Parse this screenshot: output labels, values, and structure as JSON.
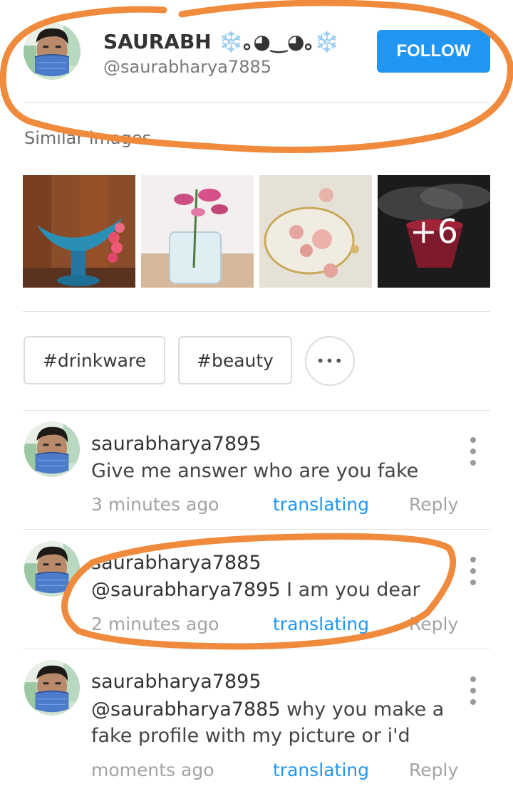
{
  "profile": {
    "name": "SAURABH ❄️｡◕‿◕｡❄️",
    "handle": "@saurabharya7885",
    "follow_label": "FOLLOW"
  },
  "similar": {
    "title": "Similar images",
    "more_count": "+6"
  },
  "tags": [
    "#drinkware",
    "#beauty"
  ],
  "tags_more_label": "•••",
  "comments": [
    {
      "user": "saurabharya7895",
      "mention": "",
      "text": "Give me answer who are you fake",
      "time": "3 minutes ago",
      "translate": "translating",
      "reply": "Reply"
    },
    {
      "user": "saurabharya7885",
      "mention": "@saurabharya7895",
      "text": " I am you dear",
      "time": "2 minutes ago",
      "translate": "translating",
      "reply": "Reply"
    },
    {
      "user": "saurabharya7895",
      "mention": "@saurabharya7885",
      "text": " why you make a fake profile with my picture or i'd",
      "time": "moments ago",
      "translate": "translating",
      "reply": "Reply"
    }
  ],
  "colors": {
    "accent": "#2196f3",
    "annotation": "#f08a3c"
  }
}
